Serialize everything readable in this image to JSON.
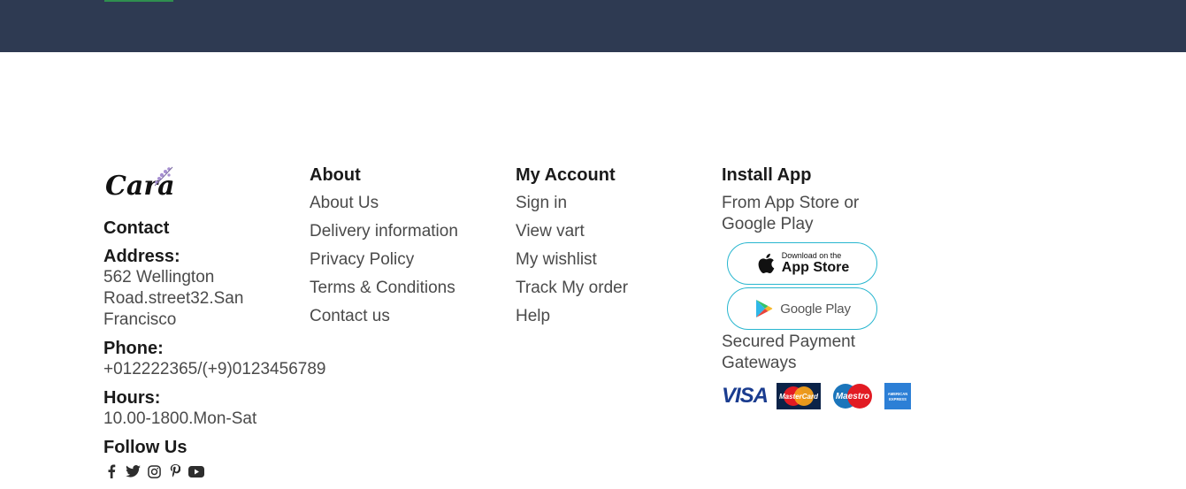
{
  "colors": {
    "top_band": "#2e3a52",
    "accent": "#2f8f4f",
    "heading": "#1a1a1a",
    "text": "#4a4a4a",
    "button_border": "#28b6cf"
  },
  "logo": {
    "text": "Cara"
  },
  "contact": {
    "title": "Contact",
    "address_label": "Address:",
    "address_line1": "562 Wellington",
    "address_line2": "Road.street32.San",
    "address_line3": "Francisco",
    "phone_label": "Phone:",
    "phone_value": "+012222365/(+9)0123456789",
    "hours_label": "Hours:",
    "hours_value": "10.00-1800.Mon-Sat",
    "follow_label": "Follow Us",
    "socials": [
      "facebook-icon",
      "twitter-icon",
      "instagram-icon",
      "pinterest-icon",
      "youtube-icon"
    ]
  },
  "about": {
    "title": "About",
    "links": [
      "About Us",
      "Delivery information",
      "Privacy Policy",
      "Terms & Conditions",
      "Contact us"
    ]
  },
  "account": {
    "title": "My Account",
    "links": [
      "Sign in",
      "View vart",
      "My wishlist",
      "Track My order",
      "Help"
    ]
  },
  "install": {
    "title": "Install App",
    "subtitle": "From App Store or Google Play",
    "appstore_small": "Download on the",
    "appstore_big": "App Store",
    "googleplay": "Google Play",
    "secured": "Secured Payment Gateways",
    "payments": [
      "VISA",
      "MasterCard",
      "Maestro",
      "AMERICAN EXPRESS"
    ]
  }
}
